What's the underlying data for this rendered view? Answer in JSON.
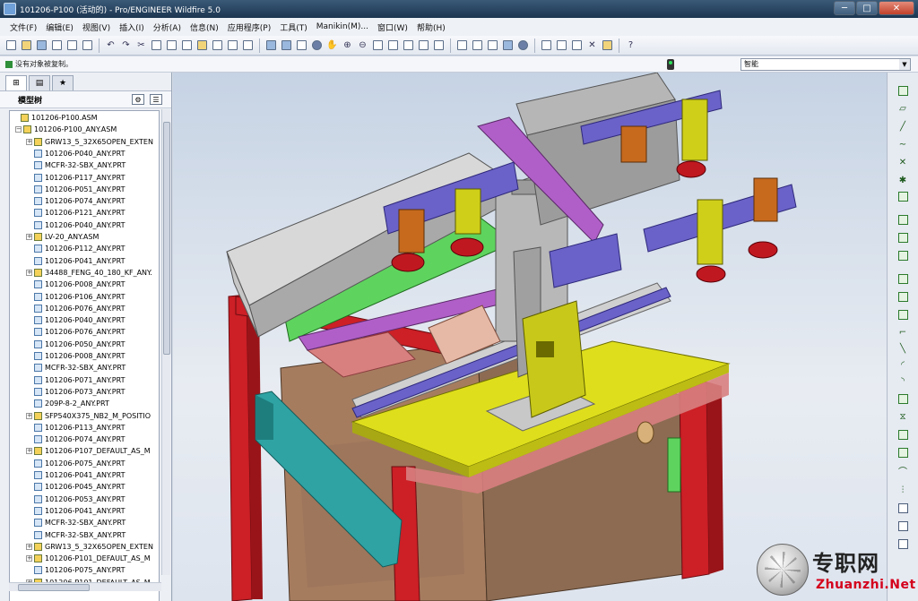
{
  "window": {
    "title": "101206-P100 (活动的) - Pro/ENGINEER Wildfire 5.0",
    "minimize": "─",
    "maximize": "□",
    "close": "✕"
  },
  "menu": [
    "文件(F)",
    "编辑(E)",
    "视图(V)",
    "插入(I)",
    "分析(A)",
    "信息(N)",
    "应用程序(P)",
    "工具(T)",
    "Manikin(M)...",
    "窗口(W)",
    "帮助(H)"
  ],
  "message": {
    "text": "没有对象被复制。"
  },
  "filter": {
    "value": "智能"
  },
  "navigator": {
    "heading": "模型树",
    "tabs": [
      "model-tree",
      "layers",
      "folder"
    ],
    "tree": [
      {
        "label": "101206-P100.ASM",
        "type": "asm",
        "level": 0,
        "expand": ""
      },
      {
        "label": "101206-P100_ANY.ASM",
        "type": "asm",
        "level": 1,
        "expand": "−"
      },
      {
        "label": "GRW13_5_32X65OPEN_EXTEN",
        "type": "asm",
        "level": 2,
        "expand": "+"
      },
      {
        "label": "101206-P040_ANY.PRT",
        "type": "prt",
        "level": 2,
        "expand": ""
      },
      {
        "label": "MCFR-32-SBX_ANY.PRT",
        "type": "prt",
        "level": 2,
        "expand": ""
      },
      {
        "label": "101206-P117_ANY.PRT",
        "type": "prt",
        "level": 2,
        "expand": ""
      },
      {
        "label": "101206-P051_ANY.PRT",
        "type": "prt",
        "level": 2,
        "expand": ""
      },
      {
        "label": "101206-P074_ANY.PRT",
        "type": "prt",
        "level": 2,
        "expand": ""
      },
      {
        "label": "101206-P121_ANY.PRT",
        "type": "prt",
        "level": 2,
        "expand": ""
      },
      {
        "label": "101206-P040_ANY.PRT",
        "type": "prt",
        "level": 2,
        "expand": ""
      },
      {
        "label": "LV-20_ANY.ASM",
        "type": "asm",
        "level": 2,
        "expand": "+"
      },
      {
        "label": "101206-P112_ANY.PRT",
        "type": "prt",
        "level": 2,
        "expand": ""
      },
      {
        "label": "101206-P041_ANY.PRT",
        "type": "prt",
        "level": 2,
        "expand": ""
      },
      {
        "label": "34488_FENG_40_180_KF_ANY.",
        "type": "asm",
        "level": 2,
        "expand": "+"
      },
      {
        "label": "101206-P008_ANY.PRT",
        "type": "prt",
        "level": 2,
        "expand": ""
      },
      {
        "label": "101206-P106_ANY.PRT",
        "type": "prt",
        "level": 2,
        "expand": ""
      },
      {
        "label": "101206-P076_ANY.PRT",
        "type": "prt",
        "level": 2,
        "expand": ""
      },
      {
        "label": "101206-P040_ANY.PRT",
        "type": "prt",
        "level": 2,
        "expand": ""
      },
      {
        "label": "101206-P076_ANY.PRT",
        "type": "prt",
        "level": 2,
        "expand": ""
      },
      {
        "label": "101206-P050_ANY.PRT",
        "type": "prt",
        "level": 2,
        "expand": ""
      },
      {
        "label": "101206-P008_ANY.PRT",
        "type": "prt",
        "level": 2,
        "expand": ""
      },
      {
        "label": "MCFR-32-SBX_ANY.PRT",
        "type": "prt",
        "level": 2,
        "expand": ""
      },
      {
        "label": "101206-P071_ANY.PRT",
        "type": "prt",
        "level": 2,
        "expand": ""
      },
      {
        "label": "101206-P073_ANY.PRT",
        "type": "prt",
        "level": 2,
        "expand": ""
      },
      {
        "label": "209P-8-2_ANY.PRT",
        "type": "prt",
        "level": 2,
        "expand": ""
      },
      {
        "label": "SFP540X375_NB2_M_POSITIO",
        "type": "asm",
        "level": 2,
        "expand": "+"
      },
      {
        "label": "101206-P113_ANY.PRT",
        "type": "prt",
        "level": 2,
        "expand": ""
      },
      {
        "label": "101206-P074_ANY.PRT",
        "type": "prt",
        "level": 2,
        "expand": ""
      },
      {
        "label": "101206-P107_DEFAULT_AS_M",
        "type": "asm",
        "level": 2,
        "expand": "+"
      },
      {
        "label": "101206-P075_ANY.PRT",
        "type": "prt",
        "level": 2,
        "expand": ""
      },
      {
        "label": "101206-P041_ANY.PRT",
        "type": "prt",
        "level": 2,
        "expand": ""
      },
      {
        "label": "101206-P045_ANY.PRT",
        "type": "prt",
        "level": 2,
        "expand": ""
      },
      {
        "label": "101206-P053_ANY.PRT",
        "type": "prt",
        "level": 2,
        "expand": ""
      },
      {
        "label": "101206-P041_ANY.PRT",
        "type": "prt",
        "level": 2,
        "expand": ""
      },
      {
        "label": "MCFR-32-SBX_ANY.PRT",
        "type": "prt",
        "level": 2,
        "expand": ""
      },
      {
        "label": "MCFR-32-SBX_ANY.PRT",
        "type": "prt",
        "level": 2,
        "expand": ""
      },
      {
        "label": "GRW13_5_32X65OPEN_EXTEN",
        "type": "asm",
        "level": 2,
        "expand": "+"
      },
      {
        "label": "101206-P101_DEFAULT_AS_M",
        "type": "asm",
        "level": 2,
        "expand": "+"
      },
      {
        "label": "101206-P075_ANY.PRT",
        "type": "prt",
        "level": 2,
        "expand": ""
      },
      {
        "label": "101206-P101_DEFAULT_AS_M",
        "type": "asm",
        "level": 2,
        "expand": "+"
      }
    ]
  },
  "watermark": {
    "cn": "专职网",
    "en": "Zhuanzhi.Net"
  },
  "colors": {
    "frame_red": "#cc1f26",
    "plate_yellow": "#dede1c",
    "rail_purple": "#6a62c8",
    "rail_magenta": "#b15fc8",
    "block_orange": "#c76a1e",
    "block_olive": "#cfcf1a",
    "cabinet_brown": "#a07a5f",
    "strut_teal": "#2fa3a3",
    "metal_gray": "#a9a9a9"
  }
}
